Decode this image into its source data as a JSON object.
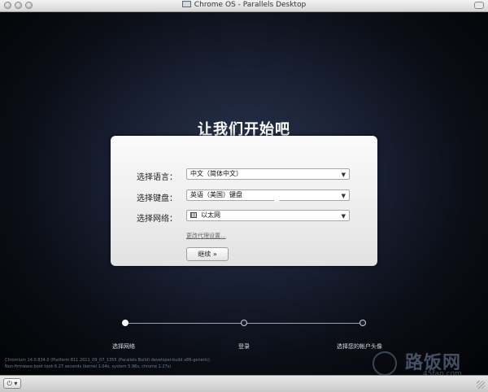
{
  "window": {
    "title": "Chrome OS - Parallels Desktop"
  },
  "screen": {
    "heading": "让我们开始吧",
    "form": {
      "language_label": "选择语言：",
      "language_value": "中文（简体中文）",
      "keyboard_label": "选择键盘：",
      "keyboard_value": "英语（美国）键盘",
      "network_label": "选择网络：",
      "network_value": "以太网",
      "proxy_link": "更改代理设置...",
      "continue_button": "继续 »"
    },
    "steps": [
      "选择网络",
      "登录",
      "选择您的帐户头像"
    ],
    "version_line1": "Chromium 14.0.834.0 (Platform 811.2011_09_07_1355 (Parallels Build)  developer-build x86-generic)",
    "version_line2": "Non-firmware boot took 6.27 seconds (kernel 1.04s, system 5.96s, chrome 1.27s)"
  },
  "watermark": {
    "main": "路饭网",
    "sub": "45fan.com"
  },
  "colors": {
    "screen_center": "#2b3550",
    "screen_edge": "#020305",
    "panel": "#f0f0f0"
  },
  "icons": {
    "power": "power-icon",
    "network": "ethernet-icon"
  }
}
